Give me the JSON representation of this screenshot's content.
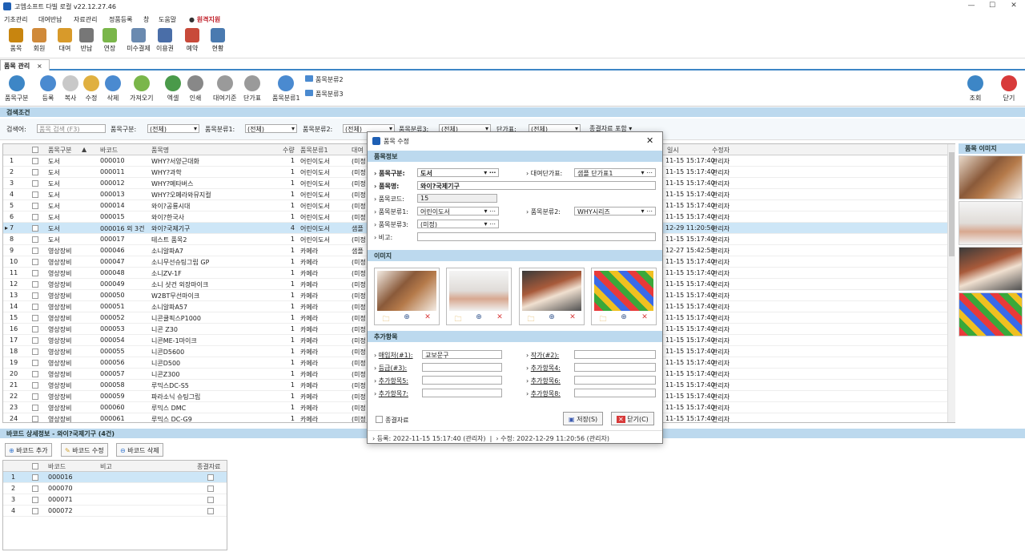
{
  "app": {
    "title": "고엠소프트 다빌 로컬 v22.12.27.46",
    "window_controls": [
      "—",
      "☐",
      "✕"
    ]
  },
  "menu": [
    "기초관리",
    "대여반납",
    "자료관리",
    "정품등록",
    "창",
    "도움말",
    "원격지원"
  ],
  "toolbar1": [
    {
      "label": "품목",
      "icon": "books-icon",
      "color": "#c8850f"
    },
    {
      "label": "회원",
      "icon": "person-icon",
      "color": "#d08a3a"
    },
    {
      "label": "대여",
      "icon": "box-icon",
      "color": "#d89a2a"
    },
    {
      "label": "반납",
      "icon": "cart-icon",
      "color": "#777777"
    },
    {
      "label": "연장",
      "icon": "extend-icon",
      "color": "#7ab64a"
    },
    {
      "label": "미수결제",
      "icon": "calculator-icon",
      "color": "#6a8ab0"
    },
    {
      "label": "이용권",
      "icon": "ticket-icon",
      "color": "#4a6ea8"
    },
    {
      "label": "예약",
      "icon": "alarm-icon",
      "color": "#c84a3a"
    },
    {
      "label": "현황",
      "icon": "clipboard-icon",
      "color": "#4a7ab0"
    }
  ],
  "tab": {
    "label": "품목 관리",
    "close": "×"
  },
  "toolbar2": [
    {
      "label": "품목구분",
      "icon": "category-icon",
      "color": "#3d86c6"
    },
    {
      "label": "등록",
      "icon": "plus-icon",
      "color": "#4a8ad0"
    },
    {
      "label": "복사",
      "icon": "copy-icon",
      "color": "#c8c8c8"
    },
    {
      "label": "수정",
      "icon": "edit-icon",
      "color": "#e0b040"
    },
    {
      "label": "삭제",
      "icon": "minus-icon",
      "color": "#4a8ad0"
    },
    {
      "label": "가져오기",
      "icon": "import-icon",
      "color": "#7ab64a"
    },
    {
      "label": "엑셀",
      "icon": "excel-icon",
      "color": "#4a9a4a"
    },
    {
      "label": "인쇄",
      "icon": "print-icon",
      "color": "#888888"
    },
    {
      "label": "대여기준",
      "icon": "gear-icon",
      "color": "#9a9a9a"
    },
    {
      "label": "단가표",
      "icon": "gear2-icon",
      "color": "#9a9a9a"
    },
    {
      "label": "품목분류1",
      "icon": "tree-icon",
      "color": "#4a8ad0"
    },
    {
      "label": "품목분류2",
      "icon": "tree2-icon",
      "color": "#4a8ad0"
    },
    {
      "label": "품목분류3",
      "icon": "tree3-icon",
      "color": "#4a8ad0"
    },
    {
      "label": "조회",
      "icon": "refresh-icon",
      "color": "#3d86c6"
    },
    {
      "label": "닫기",
      "icon": "close-icon",
      "color": "#d83a3a"
    }
  ],
  "search": {
    "section": "검색조건",
    "f_search": "검색어:",
    "f_search_ph": "품목 검색 (F3)",
    "f_cat": "품목구분:",
    "f_cat_v": "(전체)",
    "f_c1": "품목분류1:",
    "f_c1_v": "(전체)",
    "f_c2": "품목분류2:",
    "f_c2_v": "(전체)",
    "f_c3": "품목분류3:",
    "f_c3_v": "(전체)",
    "f_price": "단가표:",
    "f_price_v": "(전체)",
    "f_end": "종결자료 포함"
  },
  "grid": {
    "headers": [
      "품목구분",
      "바코드",
      "품목명",
      "수량",
      "품목분류1",
      "대여",
      "일시",
      "수정자"
    ],
    "rows": [
      [
        "1",
        "도서",
        "000010",
        "WHY?서양근대화",
        "1",
        "어린이도서",
        "(미정",
        "11-15 15:17:40",
        "관리자"
      ],
      [
        "2",
        "도서",
        "000011",
        "WHY?과학",
        "1",
        "어린이도서",
        "(미정",
        "11-15 15:17:40",
        "관리자"
      ],
      [
        "3",
        "도서",
        "000012",
        "WHY?메타버스",
        "1",
        "어린이도서",
        "(미정",
        "11-15 15:17:40",
        "관리자"
      ],
      [
        "4",
        "도서",
        "000013",
        "WHY?오페라와뮤지컬",
        "1",
        "어린이도서",
        "(미정",
        "11-15 15:17:40",
        "관리자"
      ],
      [
        "5",
        "도서",
        "000014",
        "와이?공룡시대",
        "1",
        "어린이도서",
        "(미정",
        "11-15 15:17:40",
        "관리자"
      ],
      [
        "6",
        "도서",
        "000015",
        "와이?한국사",
        "1",
        "어린이도서",
        "(미정",
        "11-15 15:17:40",
        "관리자"
      ],
      [
        "7",
        "도서",
        "000016 외 3건",
        "와이?국제기구",
        "4",
        "어린이도서",
        "샘플",
        "12-29 11:20:56",
        "관리자"
      ],
      [
        "8",
        "도서",
        "000017",
        "테스트 품목2",
        "1",
        "어린이도서",
        "(미정",
        "11-15 15:17:40",
        "관리자"
      ],
      [
        "9",
        "영상장비",
        "000046",
        "소니알파A7",
        "1",
        "카메라",
        "샘플",
        "12-27 15:42:58",
        "관리자"
      ],
      [
        "10",
        "영상장비",
        "000047",
        "소니무선슈팅그립 GP",
        "1",
        "카메라",
        "(미정",
        "11-15 15:17:40",
        "관리자"
      ],
      [
        "11",
        "영상장비",
        "000048",
        "소니ZV-1F",
        "1",
        "카메라",
        "(미정",
        "11-15 15:17:40",
        "관리자"
      ],
      [
        "12",
        "영상장비",
        "000049",
        "소니 샷건 외장마이크",
        "1",
        "카메라",
        "(미정",
        "11-15 15:17:40",
        "관리자"
      ],
      [
        "13",
        "영상장비",
        "000050",
        "W2BT무선마이크",
        "1",
        "카메라",
        "(미정",
        "11-15 15:17:40",
        "관리자"
      ],
      [
        "14",
        "영상장비",
        "000051",
        "소니알파A57",
        "1",
        "카메라",
        "(미정",
        "11-15 15:17:40",
        "관리자"
      ],
      [
        "15",
        "영상장비",
        "000052",
        "니콘쿨픽스P1000",
        "1",
        "카메라",
        "(미정",
        "11-15 15:17:40",
        "관리자"
      ],
      [
        "16",
        "영상장비",
        "000053",
        "니콘 Z30",
        "1",
        "카메라",
        "(미정",
        "11-15 15:17:40",
        "관리자"
      ],
      [
        "17",
        "영상장비",
        "000054",
        "니콘ME-1마이크",
        "1",
        "카메라",
        "(미정",
        "11-15 15:17:40",
        "관리자"
      ],
      [
        "18",
        "영상장비",
        "000055",
        "니콘D5600",
        "1",
        "카메라",
        "(미정",
        "11-15 15:17:40",
        "관리자"
      ],
      [
        "19",
        "영상장비",
        "000056",
        "니콘D500",
        "1",
        "카메라",
        "(미정",
        "11-15 15:17:40",
        "관리자"
      ],
      [
        "20",
        "영상장비",
        "000057",
        "니콘Z300",
        "1",
        "카메라",
        "(미정",
        "11-15 15:17:40",
        "관리자"
      ],
      [
        "21",
        "영상장비",
        "000058",
        "루믹스DC-S5",
        "1",
        "카메라",
        "(미정",
        "11-15 15:17:40",
        "관리자"
      ],
      [
        "22",
        "영상장비",
        "000059",
        "파라소닉 슈팅그립",
        "1",
        "카메라",
        "(미정",
        "11-15 15:17:40",
        "관리자"
      ],
      [
        "23",
        "영상장비",
        "000060",
        "루믹스 DMC",
        "1",
        "카메라",
        "(미정",
        "11-15 15:17:40",
        "관리자"
      ],
      [
        "24",
        "영상장비",
        "000061",
        "루믹스 DC-G9",
        "1",
        "카메라",
        "(미정",
        "11-15 15:17:40",
        "관리자"
      ]
    ]
  },
  "images_panel": {
    "title": "품목 이미지"
  },
  "barcode": {
    "section": "바코드 상세정보 - 와이?국제기구 (4건)",
    "btn_add": "바코드 추가",
    "btn_edit": "바코드 수정",
    "btn_del": "바코드 삭제",
    "headers": [
      "바코드",
      "비고",
      "종결자료"
    ],
    "rows": [
      [
        "1",
        "000016"
      ],
      [
        "2",
        "000070"
      ],
      [
        "3",
        "000071"
      ],
      [
        "4",
        "000072"
      ]
    ]
  },
  "dialog": {
    "title": "품목 수정",
    "sec_info": "품목정보",
    "l_cat": "품목구분:",
    "v_cat": "도서",
    "l_price": "대여단가표:",
    "v_price": "샘플 단가표1",
    "l_name": "품목명:",
    "v_name": "와이?국제기구",
    "l_code": "품목코드:",
    "v_code": "15",
    "l_c1": "품목분류1:",
    "v_c1": "어린이도서",
    "l_c2": "품목분류2:",
    "v_c2": "WHY시리즈",
    "l_c3": "품목분류3:",
    "v_c3": "(미정)",
    "l_note": "비고:",
    "sec_img": "이미지",
    "sec_extra": "추가항목",
    "l_e1": "매입처(#1):",
    "v_e1": "교보문구",
    "l_e2": "작가(#2):",
    "l_e3": "등급(#3):",
    "l_e4": "추가항목4:",
    "l_e5": "추가항목5:",
    "l_e6": "추가항목6:",
    "l_e7": "추가항목7:",
    "l_e8": "추가항목8:",
    "l_end": "종결자료",
    "btn_save": "저장(S)",
    "btn_close": "닫기(C)",
    "footer_reg": "등록: 2022-11-15 15:17:40 (관리자)",
    "footer_mod": "수정: 2022-12-29 11:20:56 (관리자)"
  }
}
